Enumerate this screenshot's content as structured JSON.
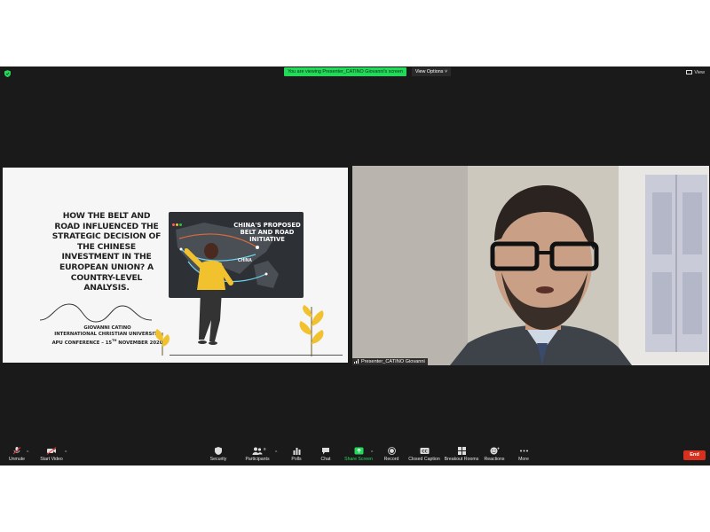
{
  "topbar": {
    "banner_text": "You are viewing Presenter_CATINO Giovanni's screen",
    "view_options_label": "View Options",
    "view_label": "View"
  },
  "slide": {
    "title": "HOW THE BELT AND ROAD INFLUENCED THE STRATEGIC DECISION OF THE CHINESE INVESTMENT IN THE EUROPEAN UNION? A COUNTRY-LEVEL ANALYSIS.",
    "author": "GIOVANNI CATINO",
    "university": "INTERNATIONAL CHRISTIAN UNIVERSITY",
    "conference": "APU CONFERENCE – 15",
    "conference_sup": "TH",
    "conference_date": "NOVEMBER 2020",
    "map_title": "CHINA'S PROPOSED BELT AND ROAD INITIATIVE",
    "map_country_label": "CHINA"
  },
  "camera": {
    "name_label": "Presenter_CATINO Giovanni"
  },
  "toolbar": {
    "unmute": "Unmute",
    "start_video": "Start Video",
    "security": "Security",
    "participants": "Participants",
    "participants_count": "9",
    "polls": "Polls",
    "chat": "Chat",
    "share_screen": "Share Screen",
    "record": "Record",
    "closed_caption": "Closed Caption",
    "breakout_rooms": "Breakout Rooms",
    "reactions": "Reactions",
    "more": "More",
    "end": "End"
  },
  "colors": {
    "accent_green": "#23d959",
    "end_red": "#d6311f",
    "app_bg": "#1a1a1a"
  },
  "icons": [
    "shield-icon",
    "view-icon",
    "mic-muted-icon",
    "video-off-icon",
    "security-icon",
    "participants-icon",
    "polls-icon",
    "chat-icon",
    "share-screen-icon",
    "record-icon",
    "closed-caption-icon",
    "breakout-rooms-icon",
    "reactions-icon",
    "more-icon"
  ]
}
